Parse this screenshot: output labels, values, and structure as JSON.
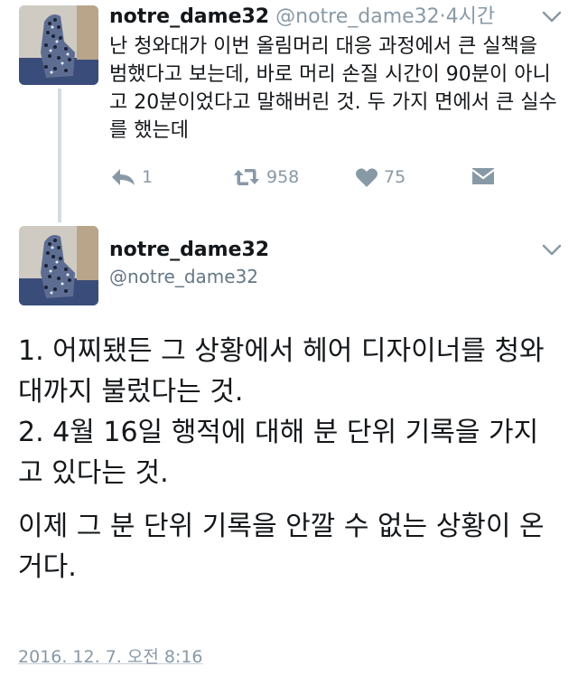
{
  "tweet1": {
    "username": "notre_dame32",
    "handle": "@notre_dame32",
    "separator": "·",
    "time": "4시간",
    "body": "난 청와대가 이번 올림머리 대응 과정에서 큰 실책을 범했다고 보는데, 바로 머리 손질 시간이 90분이 아니고 20분이었다고 말해버린 것. 두 가지 면에서 큰 실수를 했는데",
    "actions": {
      "reply_count": "1",
      "retweet_count": "958",
      "like_count": "75"
    },
    "icons": [
      "reply-icon",
      "retweet-icon",
      "heart-icon",
      "message-icon",
      "chevron-down-icon"
    ]
  },
  "tweet2": {
    "username": "notre_dame32",
    "handle": "@notre_dame32",
    "paragraph1_line1": "1. 어찌됐든 그 상황에서 헤어 디자이너를 청와대까지 불렀다는 것.",
    "paragraph1_line2": "2. 4월 16일 행적에 대해 분 단위 기록을 가지고 있다는 것.",
    "paragraph2": "이제 그 분 단위 기록을 안깔 수 없는 상황이 온거다.",
    "timestamp": "2016. 12. 7. 오전 8:16"
  },
  "colors": {
    "text": "#14171a",
    "muted": "#8899a6",
    "thread_line": "#d5dbe0"
  }
}
